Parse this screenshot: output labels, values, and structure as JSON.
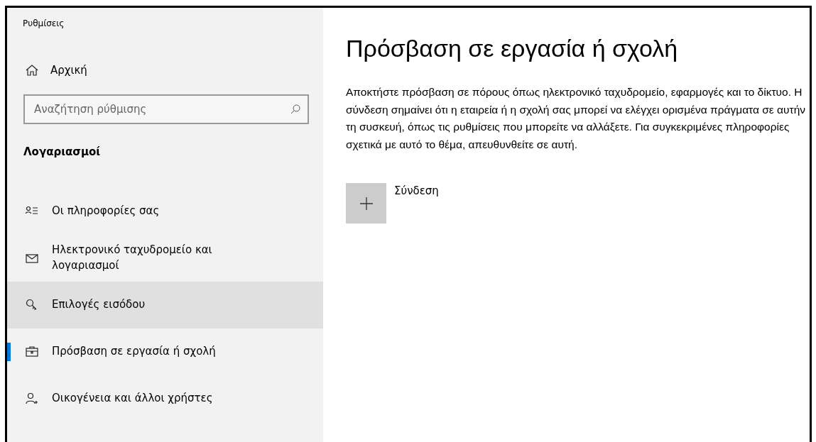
{
  "window": {
    "title": "Ρυθμίσεις"
  },
  "sidebar": {
    "home": "Αρχική",
    "search": {
      "placeholder": "Αναζήτηση ρύθμισης"
    },
    "section": "Λογαριασμοί",
    "items": [
      {
        "kind": "info",
        "label": "Οι πληροφορίες σας",
        "selected": false,
        "hovered": false
      },
      {
        "kind": "mail",
        "label": "Ηλεκτρονικό ταχυδρομείο και λογαριασμοί",
        "selected": false,
        "hovered": false
      },
      {
        "kind": "key",
        "label": "Επιλογές εισόδου",
        "selected": false,
        "hovered": true
      },
      {
        "kind": "briefcase",
        "label": "Πρόσβαση σε εργασία ή σχολή",
        "selected": true,
        "hovered": false
      },
      {
        "kind": "family",
        "label": "Οικογένεια και άλλοι χρήστες",
        "selected": false,
        "hovered": false
      }
    ]
  },
  "main": {
    "title": "Πρόσβαση σε εργασία ή σχολή",
    "description": "Αποκτήστε πρόσβαση σε πόρους όπως ηλεκτρονικό ταχυδρομείο, εφαρμογές και το δίκτυο. Η σύνδεση σημαίνει ότι η εταιρεία ή η σχολή σας μπορεί να ελέγχει ορισμένα πράγματα σε αυτήν τη συσκευή, όπως τις ρυθμίσεις που μπορείτε να αλλάξετε. Για συγκεκριμένες πληροφορίες σχετικά με αυτό το θέμα, απευθυνθείτε σε αυτή.",
    "connect": "Σύνδεση"
  }
}
